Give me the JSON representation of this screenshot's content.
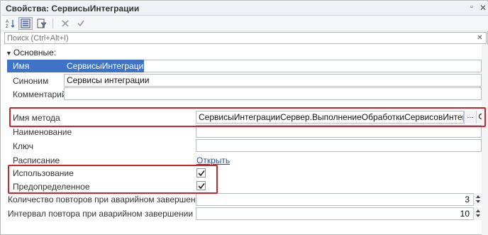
{
  "window": {
    "title": "Свойства: СервисыИнтеграции",
    "pin_icon": "pin-icon",
    "close_icon": "close-icon"
  },
  "toolbar": {
    "buttons": [
      {
        "name": "sort-az-icon"
      },
      {
        "name": "categories-icon",
        "active": true
      },
      {
        "name": "filter-icon"
      },
      {
        "name": "delete-icon"
      },
      {
        "name": "apply-icon"
      }
    ]
  },
  "search": {
    "placeholder": "Поиск (Ctrl+Alt+I)"
  },
  "group": {
    "label": "Основные:"
  },
  "fields": {
    "name": {
      "label": "Имя",
      "value": "СервисыИнтеграции"
    },
    "synonym": {
      "label": "Синоним",
      "value": "Сервисы интеграции"
    },
    "comment": {
      "label": "Комментарий",
      "value": ""
    },
    "method": {
      "label": "Имя метода",
      "value": "СервисыИнтеграцииСервер.ВыполнениеОбработкиСервисовИнтеграции",
      "dots": "..."
    },
    "title": {
      "label": "Наименование",
      "value": ""
    },
    "key": {
      "label": "Ключ",
      "value": ""
    },
    "schedule": {
      "label": "Расписание",
      "link": "Открыть"
    },
    "use": {
      "label": "Использование",
      "checked": true
    },
    "predefined": {
      "label": "Предопределенное",
      "checked": true
    },
    "retry_count": {
      "label": "Количество повторов при аварийном завершении",
      "value": "3"
    },
    "retry_interval": {
      "label": "Интервал повтора при аварийном завершении",
      "value": "10"
    }
  },
  "colors": {
    "selection": "#3f73c8",
    "highlight_box": "#d6202a",
    "link": "#2a4fa0"
  }
}
